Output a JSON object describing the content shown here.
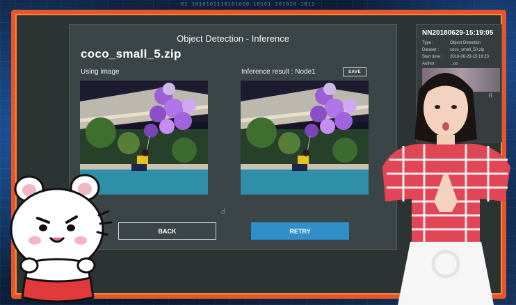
{
  "background": {
    "binary_text": "01 1010101110101010 10101 101010 1011"
  },
  "dialog": {
    "title": "Object Detection - Inference",
    "file_name": "coco_small_5.zip",
    "using_image_label": "Using image",
    "result_label": "Inference result : Node1",
    "save_label": "SAVE",
    "back_label": "BACK",
    "retry_label": "RETRY"
  },
  "info_panel": {
    "title": "NN20180629-15:19:05",
    "rows": [
      {
        "key": "Type :",
        "value": "Object Detection"
      },
      {
        "key": "Dataset :",
        "value": "coco_small_50.zip"
      },
      {
        "key": "Start time :",
        "value": "2018-06-29-15:19:23"
      },
      {
        "key": "Author :",
        "value": "...oo"
      }
    ],
    "thumb_label": "(("
  },
  "colors": {
    "frame": "#e8552a",
    "dialog_bg": "#3b4446",
    "retry_button": "#2f8fc8",
    "balloon": "#9b5fd6"
  },
  "icons": {
    "cursor": "hand-pointer-icon"
  }
}
